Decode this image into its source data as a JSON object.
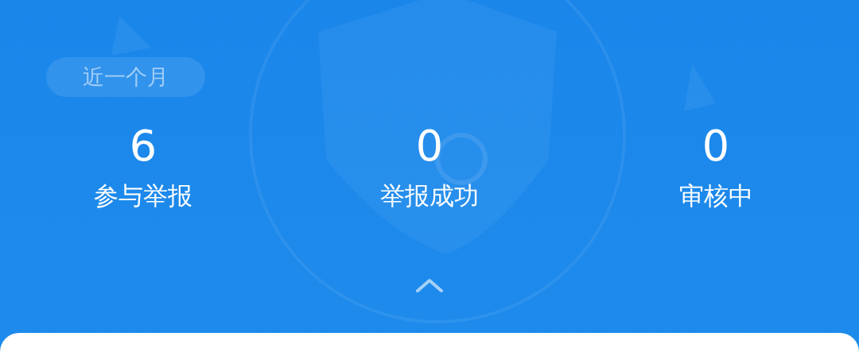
{
  "period_badge": "近一个月",
  "stats": [
    {
      "value": "6",
      "label": "参与举报"
    },
    {
      "value": "0",
      "label": "举报成功"
    },
    {
      "value": "0",
      "label": "审核中"
    }
  ],
  "collapse_toggle": {
    "expanded": true
  }
}
